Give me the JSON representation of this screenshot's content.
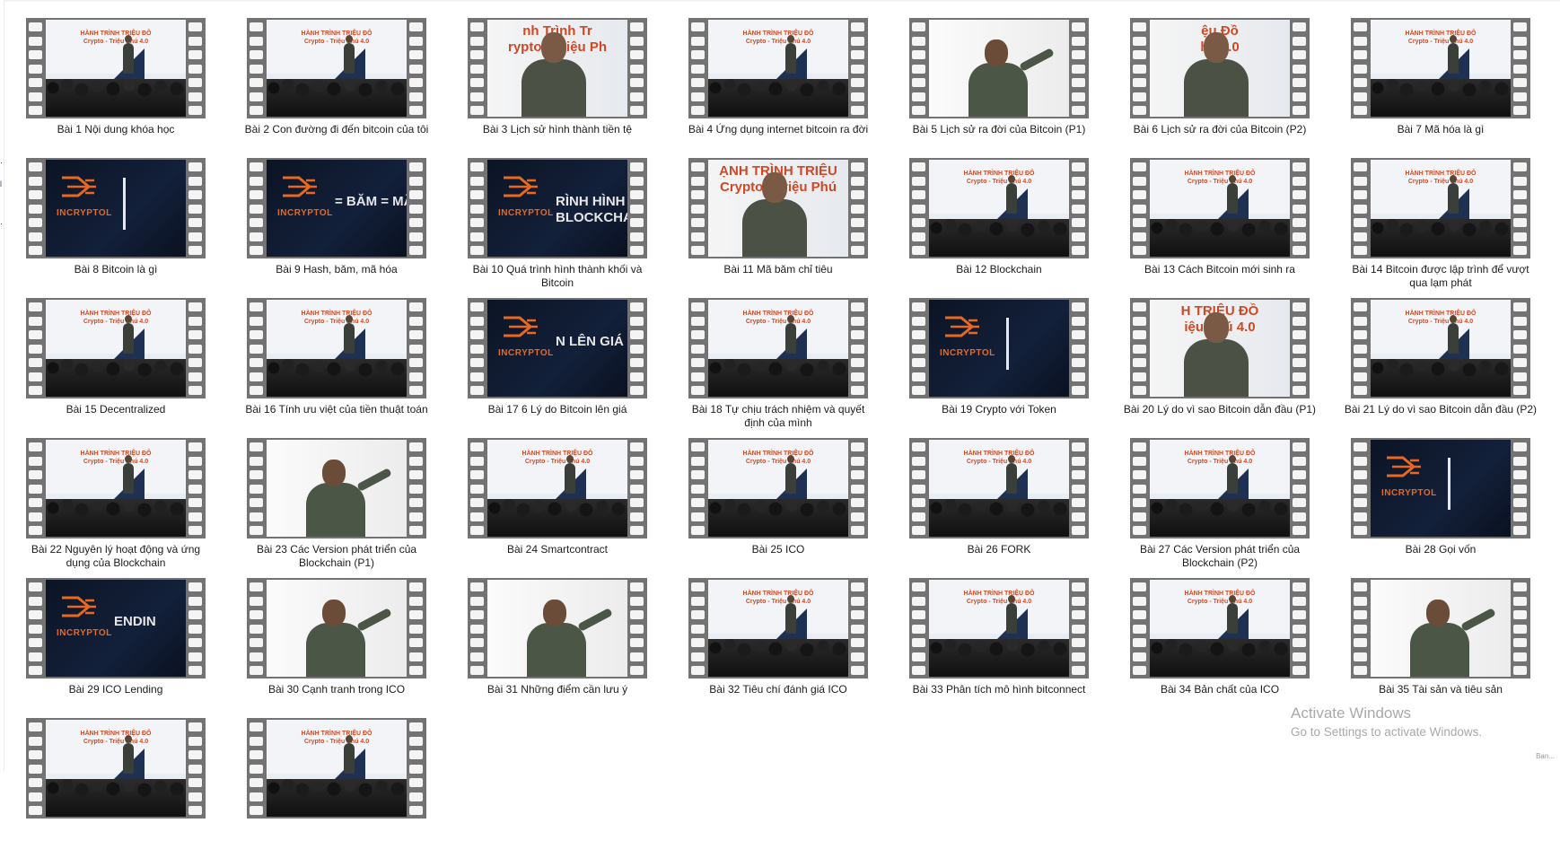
{
  "window": {
    "background": "#ffffff"
  },
  "left_edge_marks": [
    "·",
    "l",
    "·"
  ],
  "videos": [
    {
      "label": "Bài 1 Nội dung khóa học",
      "frame": "stage"
    },
    {
      "label": "Bài 2 Con đường đi đến bitcoin của tôi",
      "frame": "stage"
    },
    {
      "label": "Bài 3 Lịch sử hình thành tiền tệ",
      "frame": "closeup",
      "overlay": "nh Trình Tr\nrypto - Triệu Ph"
    },
    {
      "label": "Bài 4 Ứng dụng internet bitcoin ra đời",
      "frame": "stage"
    },
    {
      "label": "Bài 5 Lịch sử ra đời của Bitcoin (P1)",
      "frame": "board"
    },
    {
      "label": "Bài 6 Lịch sử ra đời của Bitcoin (P2)",
      "frame": "closeup",
      "overlay": "ệu Đồ\nhú 4.0"
    },
    {
      "label": "Bài 7 Mã hóa là gì",
      "frame": "stage"
    },
    {
      "label": "Bài 8 Bitcoin là gì",
      "frame": "logo",
      "overlay": ""
    },
    {
      "label": "Bài 9 Hash, băm, mã hóa",
      "frame": "logo",
      "overlay": "= BĂM = MÃ H"
    },
    {
      "label": "Bài 10 Quá trình hình thành khối và Bitcoin",
      "frame": "logo",
      "overlay": "RÌNH HÌNH TH\nBLOCKCHAIN"
    },
    {
      "label": "Bài 11 Mã băm chỉ tiêu",
      "frame": "closeup",
      "overlay": "ẠNH TRÌNH TRIỆU\nCrypto - Triệu Phú"
    },
    {
      "label": "Bài 12 Blockchain",
      "frame": "stage"
    },
    {
      "label": "Bài 13 Cách Bitcoin mới sinh ra",
      "frame": "stage"
    },
    {
      "label": "Bài 14 Bitcoin được lập trình để vượt qua lạm phát",
      "frame": "stage"
    },
    {
      "label": "Bài 15 Decentralized",
      "frame": "stage"
    },
    {
      "label": "Bài 16 Tính ưu việt của tiền thuật toán",
      "frame": "stage"
    },
    {
      "label": "Bài 17 6 Lý do Bitcoin lên giá",
      "frame": "logo",
      "overlay": "N LÊN GIÁ"
    },
    {
      "label": "Bài 18 Tự chịu trách nhiệm và quyết định của mình",
      "frame": "stage"
    },
    {
      "label": "Bài 19 Crypto với Token",
      "frame": "logo",
      "overlay": ""
    },
    {
      "label": "Bài 20 Lý do vì sao Bitcoin dẫn đầu (P1)",
      "frame": "closeup",
      "overlay": "H TRIỆU ĐỒ\niệu Phú 4.0"
    },
    {
      "label": "Bài 21 Lý do vì sao Bitcoin dẫn đầu (P2)",
      "frame": "stage"
    },
    {
      "label": "Bài 22 Nguyên lý hoạt động và ứng dụng của Blockchain",
      "frame": "stage"
    },
    {
      "label": "Bài 23 Các Version phát triển của Blockchain (P1)",
      "frame": "board"
    },
    {
      "label": "Bài 24 Smartcontract",
      "frame": "stage"
    },
    {
      "label": "Bài 25 ICO",
      "frame": "stage"
    },
    {
      "label": "Bài 26 FORK",
      "frame": "stage"
    },
    {
      "label": "Bài 27 Các Version phát triển của Blockchain (P2)",
      "frame": "stage"
    },
    {
      "label": "Bài 28 Gọi vốn",
      "frame": "logo",
      "overlay": ""
    },
    {
      "label": "Bài 29 ICO Lending",
      "frame": "logo",
      "overlay": "ENDIN"
    },
    {
      "label": "Bài 30 Cạnh tranh trong ICO",
      "frame": "board"
    },
    {
      "label": "Bài 31 Những điểm cần lưu ý",
      "frame": "board"
    },
    {
      "label": "Bài 32 Tiêu chí đánh giá ICO",
      "frame": "stage"
    },
    {
      "label": "Bài 33 Phân tích mô hình bitconnect",
      "frame": "stage"
    },
    {
      "label": "Bài 34 Bản chất của ICO",
      "frame": "stage"
    },
    {
      "label": "Bài 35 Tài sản và tiêu sản",
      "frame": "board"
    },
    {
      "label": "",
      "frame": "stage"
    },
    {
      "label": "",
      "frame": "stage"
    }
  ],
  "thumbnail_text": {
    "stage_line1": "HÀNH TRÌNH TRIỆU ĐÔ",
    "stage_line2": "Crypto - Triệu Phú 4.0",
    "logo_brand": "INCRYPTOL"
  },
  "colors": {
    "film_strip": "#737373",
    "brand_orange": "#e9681f",
    "banner_red": "#d34b25",
    "logo_bg": "#0c1424"
  },
  "watermark": {
    "line1": "Activate Windows",
    "line2": "Go to Settings to activate Windows."
  },
  "corner_text": "Ban..."
}
